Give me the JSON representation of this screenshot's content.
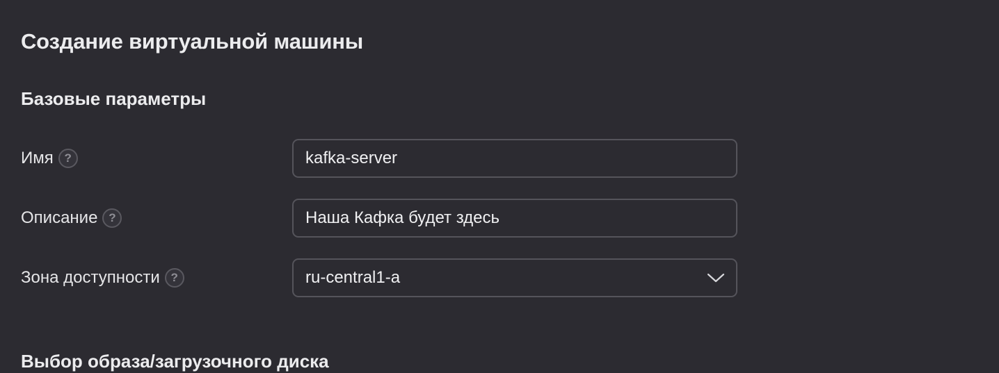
{
  "page": {
    "title": "Создание виртуальной машины"
  },
  "sections": {
    "basic": {
      "title": "Базовые параметры"
    },
    "next": {
      "title": "Выбор образа/загрузочного диска"
    }
  },
  "form": {
    "name": {
      "label": "Имя",
      "value": "kafka-server",
      "help_icon": "question-circle-icon"
    },
    "description": {
      "label": "Описание",
      "value": "Наша Кафка будет здесь",
      "help_icon": "question-circle-icon"
    },
    "zone": {
      "label": "Зона доступности",
      "value": "ru-central1-a",
      "help_icon": "question-circle-icon",
      "dropdown_icon": "chevron-down-icon"
    },
    "help_glyph": "?"
  },
  "theme": {
    "background": "#2c2b31",
    "text": "#ececee",
    "border": "#55545b"
  }
}
